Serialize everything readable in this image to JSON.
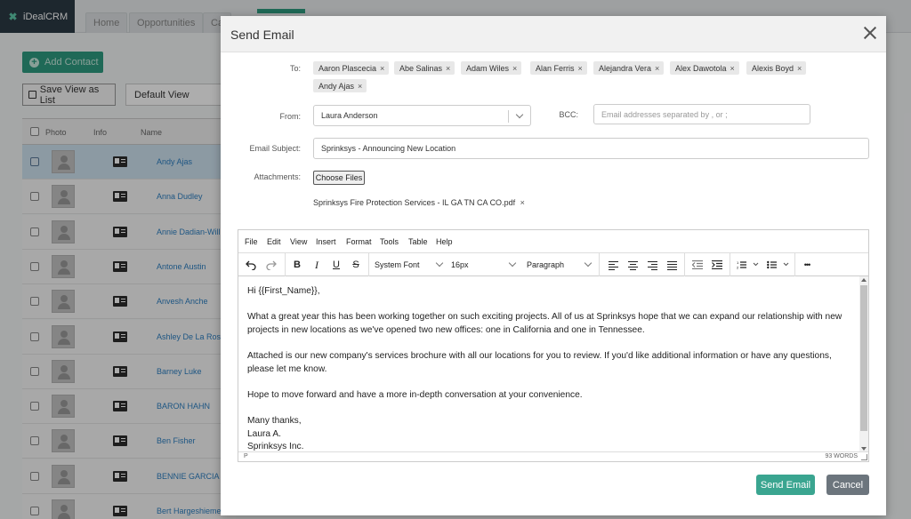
{
  "app": {
    "logo_text": "iDealCRM"
  },
  "nav": {
    "tabs": [
      "Home",
      "Opportunities",
      "Ca"
    ]
  },
  "toolbar": {
    "add_contact": "Add Contact",
    "save_view": "Save View as List",
    "default_view": "Default View"
  },
  "table": {
    "headers": {
      "photo": "Photo",
      "info": "Info",
      "name": "Name"
    },
    "rows": [
      {
        "name": "Andy Ajas",
        "selected": true
      },
      {
        "name": "Anna Dudley"
      },
      {
        "name": "Annie Dadian-Williams"
      },
      {
        "name": "Antone Austin"
      },
      {
        "name": "Anvesh Anche"
      },
      {
        "name": "Ashley De La Rosa"
      },
      {
        "name": "Barney Luke"
      },
      {
        "name": "BARON HAHN"
      },
      {
        "name": "Ben Fisher"
      },
      {
        "name": "BENNIE GARCIA"
      },
      {
        "name": "Bert Hargeshiemer"
      }
    ]
  },
  "modal": {
    "title": "Send Email",
    "to_label": "To:",
    "recipients": [
      "Aaron Plascecia",
      "Abe Salinas",
      "Adam Wiles",
      "Alan Ferris",
      "Alejandra Vera",
      "Alex Dawotola",
      "Alexis Boyd",
      "Andy Ajas"
    ],
    "chip_remove": "×",
    "from_label": "From:",
    "from_value": "Laura Anderson",
    "bcc_label": "BCC:",
    "bcc_placeholder": "Email addresses separated by , or ;",
    "subject_label": "Email Subject:",
    "subject_value": "Sprinksys - Announcing New Location",
    "attachments_label": "Attachments:",
    "choose_files": "Choose Files",
    "attachment_name": "Sprinksys Fire Protection Services - IL GA TN CA CO.pdf",
    "send_button": "Send Email",
    "cancel_button": "Cancel"
  },
  "editor": {
    "menu": [
      "File",
      "Edit",
      "View",
      "Insert",
      "Format",
      "Tools",
      "Table",
      "Help"
    ],
    "toolbar": {
      "bold": "B",
      "italic": "I",
      "underline": "U",
      "strike": "S",
      "font": "System Font",
      "size": "16px",
      "block": "Paragraph",
      "more": "•••"
    },
    "body": {
      "greeting": "Hi {{First_Name}},",
      "para1": "What a great year this has been working together on such exciting projects. All of us at Sprinksys hope that we can expand our relationship with new projects in new locations as we've opened two new offices: one in California and one in Tennessee.",
      "para2": "Attached is our new company's services brochure with all our locations for you to review. If you'd like additional information or have any questions, please let me know.",
      "para3": "Hope to move forward and have a more in-depth conversation at your convenience.",
      "closing": "Many thanks,",
      "signature": "Laura A.",
      "company": "Sprinksys Inc."
    },
    "status_path": "P",
    "word_count": "93 WORDS"
  }
}
